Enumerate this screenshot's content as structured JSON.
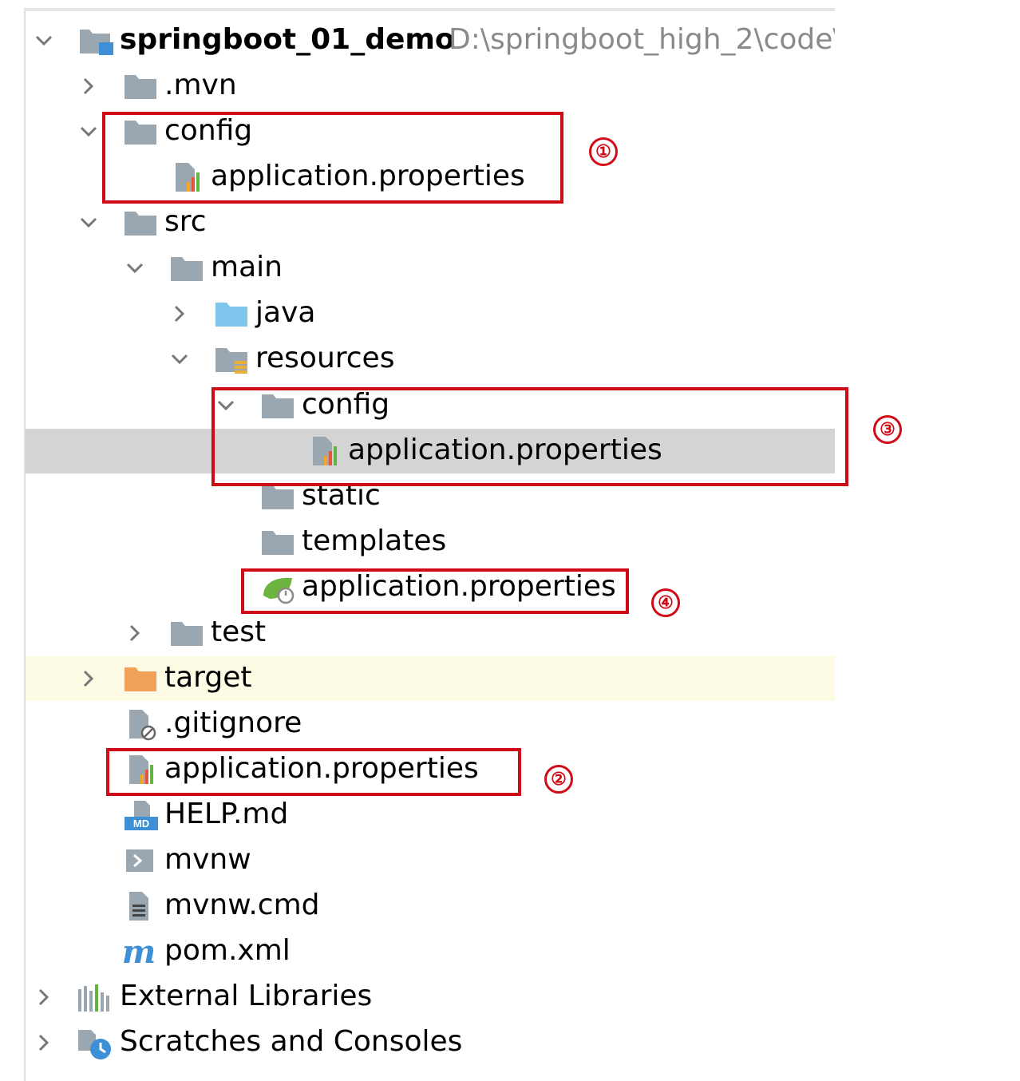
{
  "project": {
    "name": "springboot_01_demo",
    "path": "D:\\springboot_high_2\\code\\"
  },
  "tree": {
    "mvn": ".mvn",
    "config_root": "config",
    "config_root_props": "application.properties",
    "src": "src",
    "main": "main",
    "java": "java",
    "resources": "resources",
    "res_config": "config",
    "res_config_props": "application.properties",
    "static": "static",
    "templates": "templates",
    "res_props": "application.properties",
    "test": "test",
    "target": "target",
    "gitignore": ".gitignore",
    "root_props": "application.properties",
    "help": "HELP.md",
    "mvnw": "mvnw",
    "mvnw_cmd": "mvnw.cmd",
    "pom": "pom.xml",
    "external_libraries": "External Libraries",
    "scratches": "Scratches and Consoles"
  },
  "icons": {
    "md_badge": "MD",
    "maven_badge": "m"
  },
  "annotations": {
    "one": "①",
    "two": "②",
    "three": "③",
    "four": "④"
  },
  "colors": {
    "annotation": "#d10a17",
    "selection": "#d4d4d4",
    "excluded_highlight": "#fdfbe3",
    "folder": "#9aa7b0",
    "source_folder": "#7fc6ec",
    "excluded_folder": "#f2a15a"
  }
}
